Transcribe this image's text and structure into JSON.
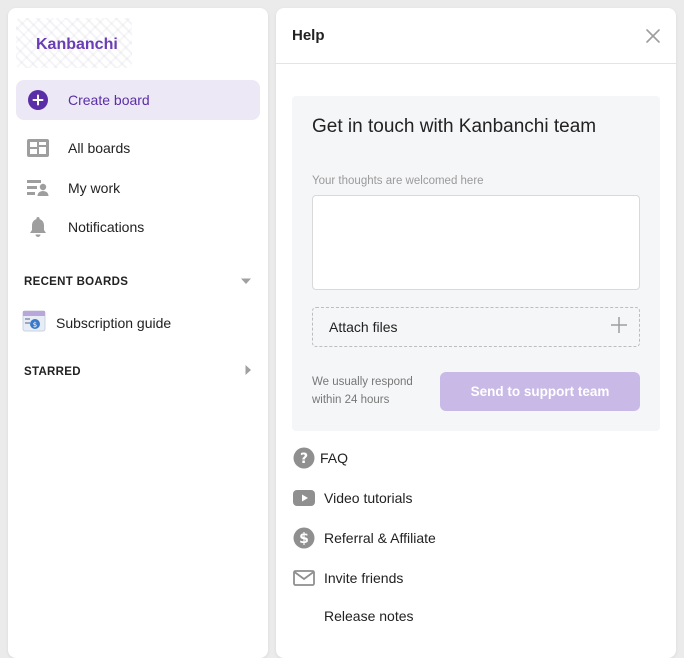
{
  "app": {
    "name": "Kanbanchi"
  },
  "sidebar": {
    "create_board": "Create board",
    "nav": [
      {
        "label": "All boards",
        "icon": "boards-icon"
      },
      {
        "label": "My work",
        "icon": "my-work-icon"
      },
      {
        "label": "Notifications",
        "icon": "bell-icon"
      }
    ],
    "recent_header": "RECENT BOARDS",
    "recent_boards": [
      {
        "label": "Subscription guide",
        "icon": "board-thumbnail-icon"
      }
    ],
    "starred_header": "STARRED"
  },
  "help": {
    "title": "Help",
    "contact": {
      "title": "Get in touch with Kanbanchi team",
      "field_label": "Your thoughts are welcomed here",
      "field_value": "",
      "attach_label": "Attach files",
      "respond_note": "We usually respond within 24 hours",
      "send_label": "Send to support team"
    },
    "links": [
      {
        "label": "FAQ",
        "icon": "question-circle-icon"
      },
      {
        "label": "Video tutorials",
        "icon": "video-play-icon"
      },
      {
        "label": "Referral & Affiliate",
        "icon": "dollar-circle-icon"
      },
      {
        "label": "Invite friends",
        "icon": "envelope-icon"
      },
      {
        "label": "Release notes",
        "icon": ""
      }
    ]
  },
  "colors": {
    "accent": "#6a3cb5",
    "active_bg": "#ede8f6",
    "send_button_disabled": "#c9b9e6",
    "icon_gray": "#9e9e9e"
  }
}
